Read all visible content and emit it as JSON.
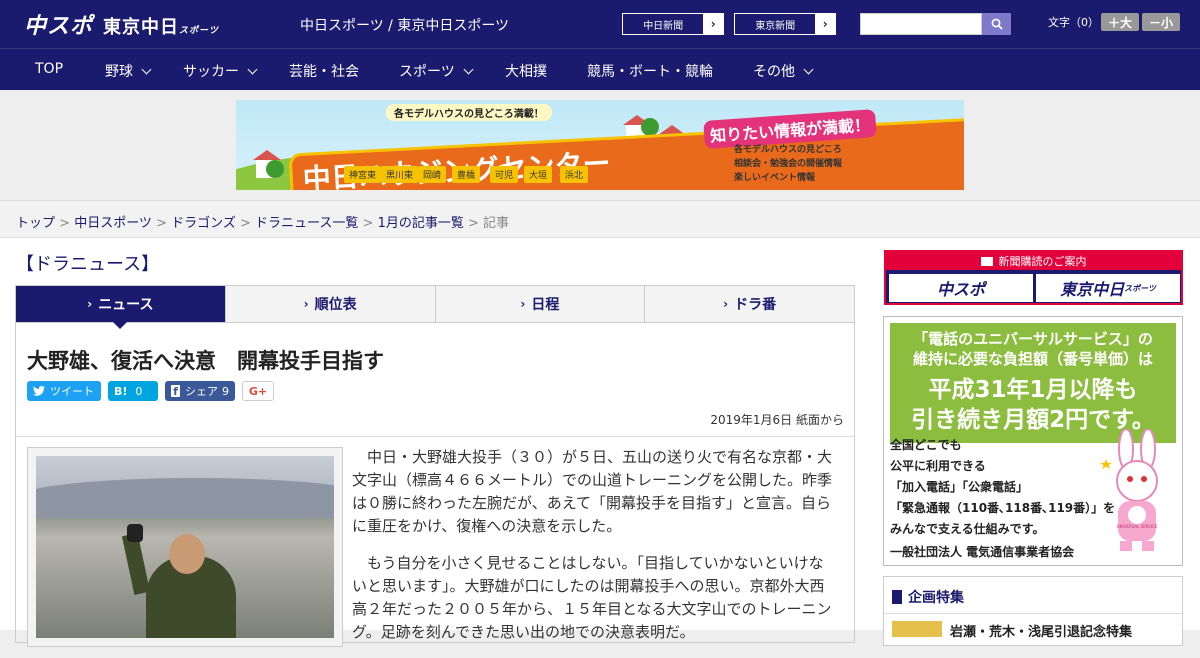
{
  "header": {
    "logo_main": "中スポ",
    "logo_sub": "東京中日",
    "logo_sub2": "スポーツ",
    "site_title": "中日スポーツ / 東京中日スポーツ",
    "paper_links": [
      "中日新聞",
      "東京新聞"
    ],
    "search_placeholder": "",
    "font_size_label": "文字（0）",
    "font_plus": "＋大",
    "font_minus": "－小"
  },
  "nav": {
    "items": [
      {
        "label": "TOP",
        "has_menu": false
      },
      {
        "label": "野球",
        "has_menu": true
      },
      {
        "label": "サッカー",
        "has_menu": true
      },
      {
        "label": "芸能・社会",
        "has_menu": false
      },
      {
        "label": "スポーツ",
        "has_menu": true
      },
      {
        "label": "大相撲",
        "has_menu": false
      },
      {
        "label": "競馬・ボート・競輪",
        "has_menu": false
      },
      {
        "label": "その他",
        "has_menu": true
      }
    ]
  },
  "banner": {
    "top_text": "各モデルハウスの見どころ満載！",
    "main_text": "中日ハウジングセンター",
    "right_text": "知りたい情報が満載！",
    "bullets": [
      "各モデルハウスの見どころ",
      "相談会・勉強会の開催情報",
      "楽しいイベント情報"
    ],
    "cities": [
      "神宮東",
      "黒川東",
      "岡崎",
      "豊橋",
      "可児",
      "大垣",
      "浜北"
    ]
  },
  "breadcrumb": {
    "links": [
      "トップ",
      "中日スポーツ",
      "ドラゴンズ",
      "ドラニュース一覧",
      "1月の記事一覧"
    ],
    "current": "記事",
    "separator": " > "
  },
  "section_title": "【ドラニュース】",
  "tabs": [
    "ニュース",
    "順位表",
    "日程",
    "ドラ番"
  ],
  "article": {
    "headline": "大野雄、復活へ決意　開幕投手目指す",
    "share": {
      "tweet": "ツイート",
      "hatena": "B!",
      "hatena_count": "0",
      "facebook": "シェア",
      "facebook_count": "9",
      "gplus": "G+"
    },
    "date": "2019年1月6日 紙面から",
    "paragraphs": [
      "中日・大野雄大投手（３０）が５日、五山の送り火で有名な京都・大文字山（標高４６６メートル）での山道トレーニングを公開した。昨季は０勝に終わった左腕だが、あえて「開幕投手を目指す」と宣言。自らに重圧をかけ、復権への決意を示した。",
      "もう自分を小さく見せることはしない。「目指していかないといけないと思います」。大野雄が口にしたのは開幕投手への思い。京都外大西高２年だった２００５年から、１５年目となる大文字山でのトレーニング。足跡を刻んできた思い出の地での決意表明だ。"
    ]
  },
  "sidebar": {
    "subscribe_title": "新聞購読のご案内",
    "subscribe_buttons": [
      "中スポ",
      "東京中日"
    ],
    "subscribe_buttons_sub": "スポーツ",
    "ad": {
      "line1": "「電話のユニバーサルサービス」の",
      "line2": "維持に必要な負担額（番号単価）は",
      "line3": "平成31年1月以降も",
      "line4": "引き続き月額2円です。",
      "body": [
        "全国どこでも",
        "公平に利用できる",
        "「加入電話」「公衆電話」",
        "「緊急通報（110番､118番､119番）」を",
        "みんなで支える仕組みです。"
      ],
      "org": "一般社団法人 電気通信事業者協会",
      "bunny_badge": "UNIVERSAL SERVICE"
    },
    "feature": {
      "title": "企画特集",
      "item": "岩瀬・荒木・浅尾引退記念特集"
    }
  },
  "colors": {
    "brand_navy": "#1a1a6e",
    "accent_red": "#e4003a",
    "twitter": "#1da1f2",
    "hatena": "#00a4de",
    "facebook": "#3b5998"
  }
}
